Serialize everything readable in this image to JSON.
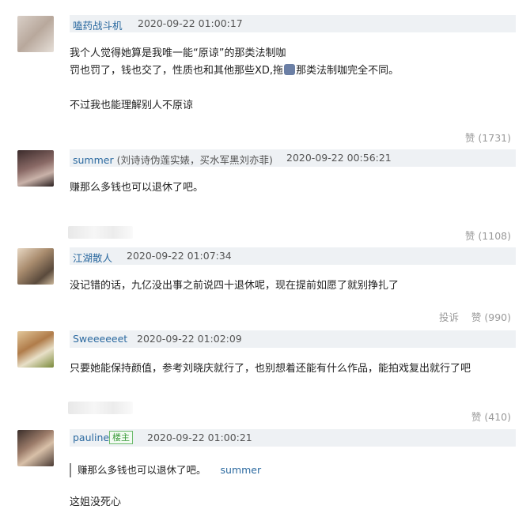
{
  "comments": [
    {
      "username": "嗑药战斗机",
      "timestamp": "2020-09-22 01:00:17",
      "lines": [
        "我个人觉得她算是我唯一能“原谅”的那类法制咖",
        "罚也罚了，钱也交了，性质也和其他那些XD,拖",
        "那类法制咖完全不同。",
        "不过我也能理解别人不原谅"
      ],
      "like_label": "赞",
      "like_count": "(1731)"
    },
    {
      "username": "summer",
      "username_note": "(刘诗诗伪莲实婊，买水军黑刘亦菲)",
      "timestamp": "2020-09-22 00:56:21",
      "lines": [
        "赚那么多钱也可以退休了吧。"
      ],
      "like_label": "赞",
      "like_count": "(1108)"
    },
    {
      "username": "江湖散人",
      "timestamp": "2020-09-22 01:07:34",
      "lines": [
        "没记错的话，九亿没出事之前说四十退休呢，现在提前如愿了就别挣扎了"
      ],
      "report_label": "投诉",
      "like_label": "赞",
      "like_count": "(990)"
    },
    {
      "username": "Sweeeeeet",
      "timestamp": "2020-09-22 01:02:09",
      "lines": [
        "只要她能保持颜值，参考刘晓庆就行了，也别想着还能有什么作品，能拍戏复出就行了吧"
      ],
      "like_label": "赞",
      "like_count": "(410)"
    },
    {
      "username": "pauline",
      "badge": "楼主",
      "timestamp": "2020-09-22 01:00:21",
      "quote_text": "赚那么多钱也可以退休了吧。",
      "quote_author": "summer",
      "lines": [
        "这姐没死心"
      ]
    }
  ]
}
